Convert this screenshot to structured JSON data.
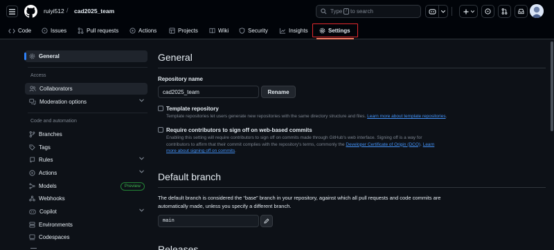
{
  "header": {
    "owner": "ruiyi512",
    "separator": "/",
    "repo": "cad2025_team",
    "search_prefix": "Type",
    "search_key": "/",
    "search_suffix": "to search"
  },
  "repo_nav": {
    "tabs": [
      {
        "label": "Code",
        "icon": "code-icon"
      },
      {
        "label": "Issues",
        "icon": "issue-icon"
      },
      {
        "label": "Pull requests",
        "icon": "pull-request-icon"
      },
      {
        "label": "Actions",
        "icon": "play-icon"
      },
      {
        "label": "Projects",
        "icon": "table-icon"
      },
      {
        "label": "Wiki",
        "icon": "book-icon"
      },
      {
        "label": "Security",
        "icon": "shield-icon"
      },
      {
        "label": "Insights",
        "icon": "graph-icon"
      },
      {
        "label": "Settings",
        "icon": "gear-icon",
        "active": true
      }
    ]
  },
  "sidebar": {
    "general": "General",
    "access_heading": "Access",
    "collaborators": "Collaborators",
    "moderation": "Moderation options",
    "code_heading": "Code and automation",
    "branches": "Branches",
    "tags": "Tags",
    "rules": "Rules",
    "actions": "Actions",
    "models": "Models",
    "models_badge": "Preview",
    "webhooks": "Webhooks",
    "copilot": "Copilot",
    "environments": "Environments",
    "codespaces": "Codespaces"
  },
  "main": {
    "title": "General",
    "repo_name_label": "Repository name",
    "repo_name_value": "cad2025_team",
    "rename_button": "Rename",
    "template": {
      "title": "Template repository",
      "desc": "Template repositories let users generate new repositories with the same directory structure and files.",
      "link": "Learn more about template repositories",
      "tail": "."
    },
    "signoff": {
      "title": "Require contributors to sign off on web-based commits",
      "desc_line1": "Enabling this setting will require contributors to sign off on commits made through GitHub's web interface. Signing off is a way for",
      "desc_line2": "contributors to affirm that their commit complies with the repository's terms, commonly the",
      "link1": "Developer Certificate of Origin (DCO)",
      "link2a": "Learn",
      "link2b": "more about signing off on commits",
      "tail": "."
    },
    "default_branch_title": "Default branch",
    "default_branch_desc_1": "The default branch is considered the “base” branch in your repository, against which all pull requests and code commits are",
    "default_branch_desc_2": "automatically made, unless you specify a different branch.",
    "default_branch_value": "main",
    "next_section_title": "Releases"
  }
}
